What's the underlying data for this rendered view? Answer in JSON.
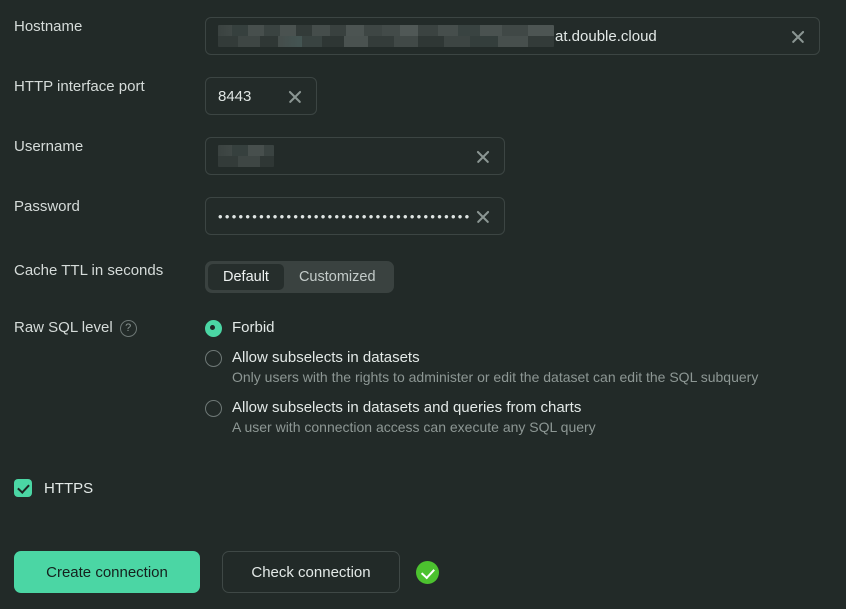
{
  "form": {
    "hostname": {
      "label": "Hostname",
      "redacted": true,
      "suffix": "at.double.cloud",
      "clear_icon": "close-icon"
    },
    "http_port": {
      "label": "HTTP interface port",
      "value": "8443",
      "clear_icon": "close-icon"
    },
    "username": {
      "label": "Username",
      "redacted": true,
      "value": "",
      "clear_icon": "close-icon"
    },
    "password": {
      "label": "Password",
      "value": "••••••••••••••••••••••••••••••••••••••••",
      "clear_icon": "close-icon"
    },
    "cache_ttl": {
      "label": "Cache TTL in seconds",
      "options": [
        "Default",
        "Customized"
      ],
      "selected": "Default"
    },
    "raw_sql": {
      "label": "Raw SQL level",
      "help_icon": "question-mark-icon",
      "selected_index": 0,
      "options": [
        {
          "label": "Forbid",
          "description": ""
        },
        {
          "label": "Allow subselects in datasets",
          "description": "Only users with the rights to administer or edit the dataset can edit the SQL subquery"
        },
        {
          "label": "Allow subselects in datasets and queries from charts",
          "description": "A user with connection access can execute any SQL query"
        }
      ]
    },
    "https": {
      "label": "HTTPS",
      "checked": true
    }
  },
  "footer": {
    "create_label": "Create connection",
    "check_label": "Check connection",
    "status_icon": "success-check-icon"
  },
  "colors": {
    "background": "#222a28",
    "accent": "#4bd6a4",
    "success": "#4cc22f",
    "text": "#e3e9e7",
    "muted_text": "#8d9794",
    "input_border": "#3c4543",
    "segment_bg": "#3a4240"
  }
}
